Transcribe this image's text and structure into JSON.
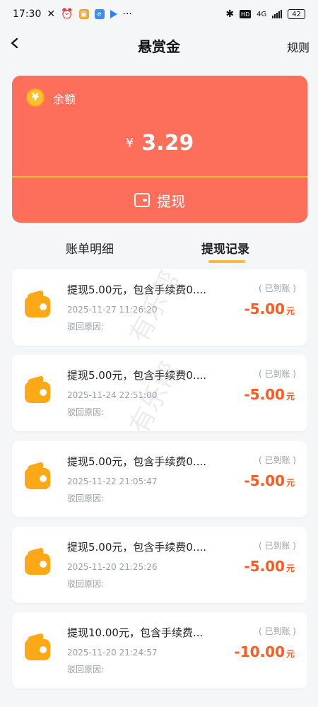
{
  "status_bar": {
    "time": "17:30",
    "battery": "42",
    "signal": "4G",
    "hd": "HD",
    "more": "···"
  },
  "nav": {
    "title": "悬赏金",
    "rules": "规则"
  },
  "balance": {
    "label": "余额",
    "currency": "¥",
    "amount": "3.29"
  },
  "actions": {
    "withdraw": "提现"
  },
  "tabs": [
    {
      "label": "账单明细"
    },
    {
      "label": "提现记录"
    }
  ],
  "records": [
    {
      "desc": "提现5.00元，包含手续费0....",
      "time": "2025-11-27 11:26:20",
      "reason_label": "驳回原因:",
      "status": "( 已到账 )",
      "amount": "-5.00",
      "unit": "元"
    },
    {
      "desc": "提现5.00元，包含手续费0....",
      "time": "2025-11-24 22:51:00",
      "reason_label": "驳回原因:",
      "status": "( 已到账 )",
      "amount": "-5.00",
      "unit": "元"
    },
    {
      "desc": "提现5.00元，包含手续费0....",
      "time": "2025-11-22 21:05:47",
      "reason_label": "驳回原因:",
      "status": "( 已到账 )",
      "amount": "-5.00",
      "unit": "元"
    },
    {
      "desc": "提现5.00元，包含手续费0....",
      "time": "2025-11-20 21:25:26",
      "reason_label": "驳回原因:",
      "status": "( 已到账 )",
      "amount": "-5.00",
      "unit": "元"
    },
    {
      "desc": "提现10.00元，包含手续费...",
      "time": "2025-11-20 21:24:57",
      "reason_label": "驳回原因:",
      "status": "( 已到账 )",
      "amount": "-10.00",
      "unit": "元"
    }
  ],
  "watermark": "有乐帮",
  "colors": {
    "card_bg": "#fe6f5b",
    "accent_yellow": "#ffb93a",
    "amount_orange": "#ff5a1f",
    "wallet_orange": "#fda816"
  }
}
